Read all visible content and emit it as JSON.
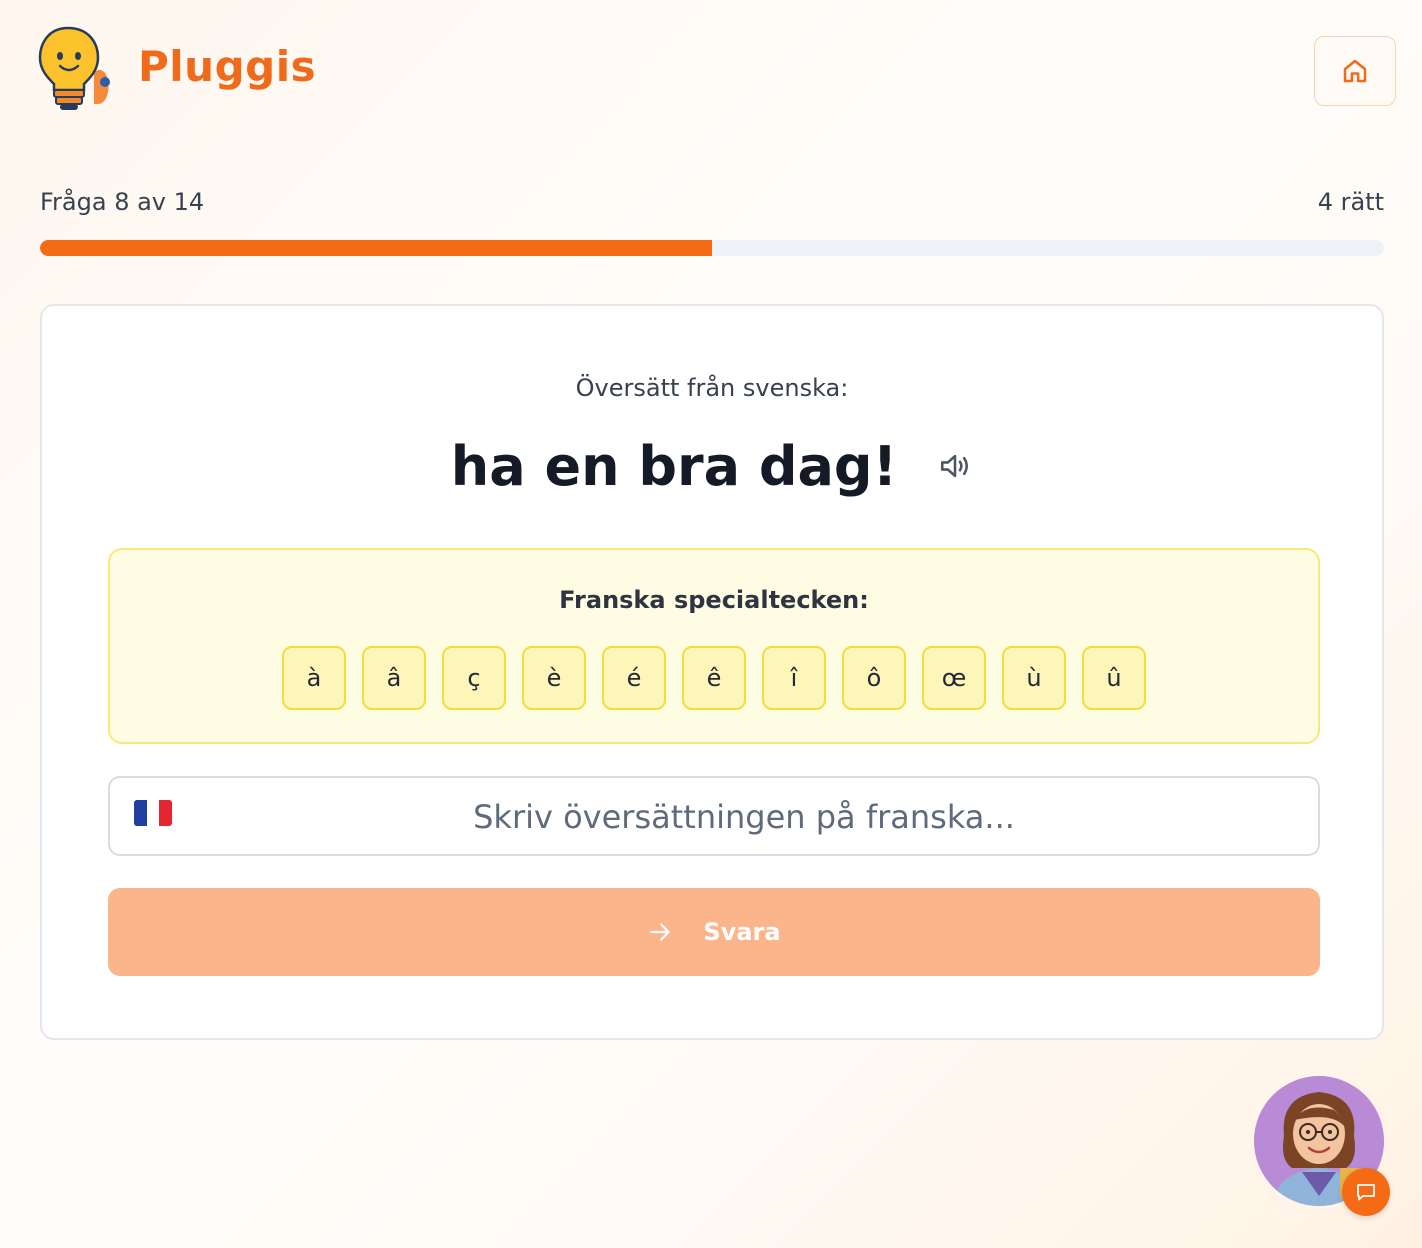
{
  "header": {
    "brand": "Pluggis",
    "logo_icon": "lightbulb-mascot-icon",
    "home_icon": "home-icon"
  },
  "progress": {
    "question_label": "Fråga 8 av 14",
    "score_label": "4 rätt",
    "fraction": 0.5,
    "fill_color": "#f46a15"
  },
  "card": {
    "instruction": "Översätt från svenska:",
    "phrase": "ha en bra dag!",
    "speaker_icon": "speaker-icon",
    "special": {
      "title": "Franska specialtecken:",
      "keys": [
        "à",
        "â",
        "ç",
        "è",
        "é",
        "ê",
        "î",
        "ô",
        "œ",
        "ù",
        "û"
      ]
    },
    "answer": {
      "flag_icon": "france-flag-icon",
      "value": "",
      "placeholder": "Skriv översättningen på franska..."
    },
    "submit": {
      "label": "Svara",
      "icon": "arrow-right-icon",
      "color": "#fbb58a"
    }
  },
  "tutor": {
    "avatar_icon": "tutor-avatar",
    "chat_icon": "chat-icon"
  }
}
